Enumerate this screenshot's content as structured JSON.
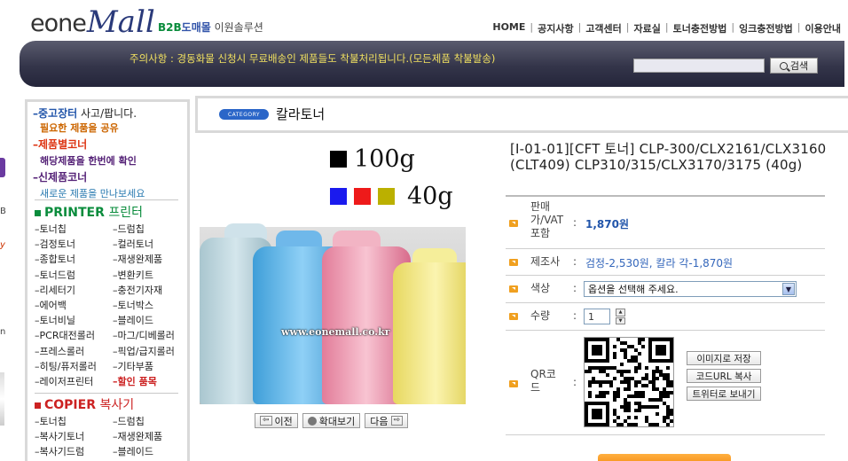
{
  "header": {
    "logo_eone": "eone",
    "logo_mall": "Mall",
    "tagline_b2b": "B2B",
    "tagline_dome": "도매몰",
    "tagline_rest": " 이원솔루션",
    "nav": [
      "HOME",
      "공지사항",
      "고객센터",
      "자료실",
      "토너충전방법",
      "잉크충전방법",
      "이용안내"
    ]
  },
  "banner": {
    "notice": "주의사항 : 경동화물 신청시 무료배송인 제품들도 착불처리됩니다.(모든제품 착불발송)",
    "search_placeholder": "",
    "search_label": "검색"
  },
  "edge_fragments": [
    "B",
    "y",
    "n"
  ],
  "sidebar": {
    "sections": [
      {
        "title": "중고장터",
        "suffix": " 사고/팝니다.",
        "sub": "필요한 제품을 공유",
        "title_color": "#2255aa",
        "sub_color": "#cc6600"
      },
      {
        "title": "제품별코너",
        "suffix": "",
        "sub": "해당제품을 한번에 확인",
        "title_color": "#dd3311",
        "sub_color": "#552277"
      },
      {
        "title": "신제품코너",
        "suffix": "",
        "sub": "새로운 제품을 만나보세요",
        "title_color": "#552277",
        "sub_color": "#2a7ab0"
      }
    ],
    "printer_head": "PRINTER",
    "printer_head_ko": " 프린터",
    "printer_items": [
      "토너칩",
      "드럼칩",
      "검정토너",
      "컬러토너",
      "종합토너",
      "재생완제품",
      "토너드럼",
      "변환키트",
      "리세터기",
      "충전기자재",
      "에어백",
      "토너박스",
      "토너비닐",
      "블레이드",
      "PCR대전롤러",
      "마그/디베롤러",
      "프레스롤러",
      "픽업/급지롤러",
      "히팅/퓨저롤러",
      "기타부품",
      "레이저프린터",
      "할인 품목"
    ],
    "copier_head": "COPIER",
    "copier_head_ko": " 복사기",
    "copier_items": [
      "토너칩",
      "드럼칩",
      "복사기토너",
      "재생완제품",
      "복사기드럼",
      "블레이드"
    ]
  },
  "main": {
    "category_badge": "CATEGORY",
    "category_title": "칼라토너"
  },
  "image": {
    "weight_black": "100g",
    "weight_color": "40g",
    "watermark": "www.eonemall.co.kr",
    "prev": "이전",
    "zoom": "확대보기",
    "next": "다음"
  },
  "product": {
    "title": "[I-01-01][CFT 토너] CLP-300/CLX2161/CLX3160 (CLT409) CLP310/315/CLX3170/3175 (40g)",
    "price_label": "판매가/VAT포함",
    "price_value": "1,870원",
    "maker_label": "제조사",
    "maker_value": "검정-2,530원, 칼라 각-1,870원",
    "color_label": "색상",
    "color_value": "옵션을 선택해 주세요.",
    "qty_label": "수량",
    "qty_value": "1",
    "qr_label": "QR코드",
    "qr_buttons": [
      "이미지로 저장",
      "코드URL 복사",
      "트위터로 보내기"
    ]
  },
  "colors": {
    "brand_navy": "#2a3a7a",
    "accent_yellow": "#f0e060",
    "price_blue": "#2255aa",
    "maker_blue": "#3366bb",
    "bullet_orange": "#f0a020",
    "badge_blue": "#2b66c8"
  },
  "icons": [
    "search-icon",
    "chevron-down-icon",
    "arrow-left-icon",
    "arrow-right-icon",
    "zoom-icon",
    "bullet-icon",
    "qr-code-icon"
  ]
}
